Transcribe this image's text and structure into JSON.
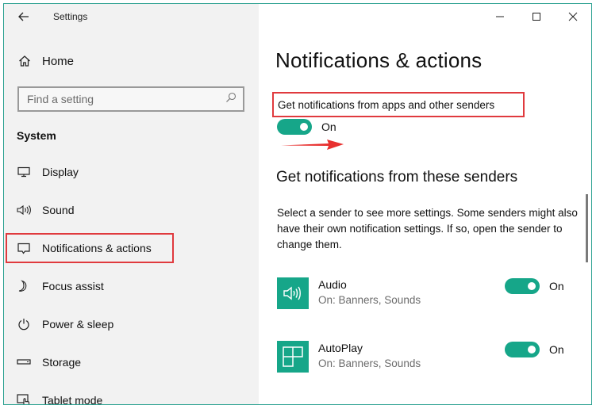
{
  "window": {
    "title": "Settings",
    "controls": {
      "minimize": "minimize-icon",
      "maximize": "maximize-icon",
      "close": "close-icon"
    }
  },
  "sidebar": {
    "back_icon": "back-arrow-icon",
    "home": {
      "label": "Home",
      "icon": "home-icon"
    },
    "search": {
      "placeholder": "Find a setting",
      "value": "",
      "icon": "search-icon"
    },
    "section_label": "System",
    "items": [
      {
        "label": "Display",
        "icon": "display-icon",
        "selected": false
      },
      {
        "label": "Sound",
        "icon": "sound-icon",
        "selected": false
      },
      {
        "label": "Notifications & actions",
        "icon": "notification-icon",
        "selected": true
      },
      {
        "label": "Focus assist",
        "icon": "moon-icon",
        "selected": false
      },
      {
        "label": "Power & sleep",
        "icon": "power-icon",
        "selected": false
      },
      {
        "label": "Storage",
        "icon": "storage-icon",
        "selected": false
      },
      {
        "label": "Tablet mode",
        "icon": "tablet-mode-icon",
        "selected": false
      }
    ]
  },
  "main": {
    "title": "Notifications & actions",
    "master_toggle": {
      "label": "Get notifications from apps and other senders",
      "state": "On",
      "enabled": true
    },
    "senders_heading": "Get notifications from these senders",
    "senders_description": "Select a sender to see more settings. Some senders might also have their own notification settings. If so, open the sender to change them.",
    "senders": [
      {
        "name": "Audio",
        "detail": "On: Banners, Sounds",
        "state": "On",
        "enabled": true,
        "icon": "audio-app-icon"
      },
      {
        "name": "AutoPlay",
        "detail": "On: Banners, Sounds",
        "state": "On",
        "enabled": true,
        "icon": "autoplay-app-icon"
      }
    ]
  },
  "annotations": {
    "highlight_color": "#e03a3e",
    "accent_color": "#16a689"
  }
}
